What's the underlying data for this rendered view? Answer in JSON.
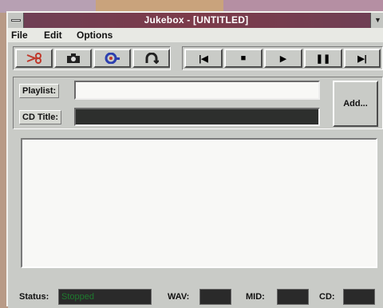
{
  "window": {
    "title": "Jukebox - [UNTITLED]"
  },
  "menu": {
    "file": "File",
    "edit": "Edit",
    "options": "Options"
  },
  "toolbar": {
    "left_icons": [
      "scissors-icon",
      "camera-icon",
      "record-icon",
      "loop-icon"
    ],
    "transport_icons": [
      "skip-back-icon",
      "stop-icon",
      "play-icon",
      "pause-icon",
      "skip-forward-icon"
    ],
    "transport_glyphs": [
      "|◀",
      "■",
      "▶",
      "❚❚",
      "▶|"
    ]
  },
  "form": {
    "playlist_label": "Playlist:",
    "playlist_value": "",
    "cd_title_label": "CD Title:",
    "cd_title_value": "",
    "add_label": "Add..."
  },
  "status": {
    "status_label": "Status:",
    "status_value": "Stopped",
    "wav_label": "WAV:",
    "mid_label": "MID:",
    "cd_label": "CD:"
  },
  "colors": {
    "title_bar": "#7c3b4a",
    "window_bg": "#c9cbc7",
    "status_text": "#1e7a2e"
  }
}
